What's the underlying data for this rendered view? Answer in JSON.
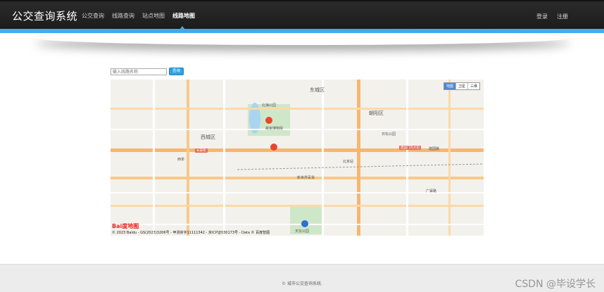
{
  "header": {
    "brand": "公交查询系统",
    "nav": [
      {
        "label": "公交查询"
      },
      {
        "label": "线路查询"
      },
      {
        "label": "站点地图"
      },
      {
        "label": "线路地图",
        "active": true
      }
    ],
    "login": "登录",
    "register": "注册"
  },
  "colors": {
    "accent": "#42aef0",
    "navbar": "#222222"
  },
  "search": {
    "placeholder": "输入线路名称",
    "button": "查询"
  },
  "map": {
    "types": [
      "地图",
      "卫星",
      "三维"
    ],
    "districts": [
      "东城区",
      "西城区",
      "朝阳区"
    ],
    "pois": [
      "故宫博物院",
      "北海公园",
      "北京站",
      "天坛公园",
      "日坛公园",
      "建国路",
      "广渠路",
      "新世界百货",
      "西单"
    ],
    "roads": [
      "长安街",
      "建国门内大街"
    ],
    "logo": "Bai度地图",
    "copyright": "© 2023 Baidu - GS(2023)3206号 - 甲测资字11111342 - 京ICP证030173号 - Data © 百度智图"
  },
  "footer": {
    "text": "© 城市公交查询系统.",
    "watermark": "CSDN @毕设学长"
  }
}
